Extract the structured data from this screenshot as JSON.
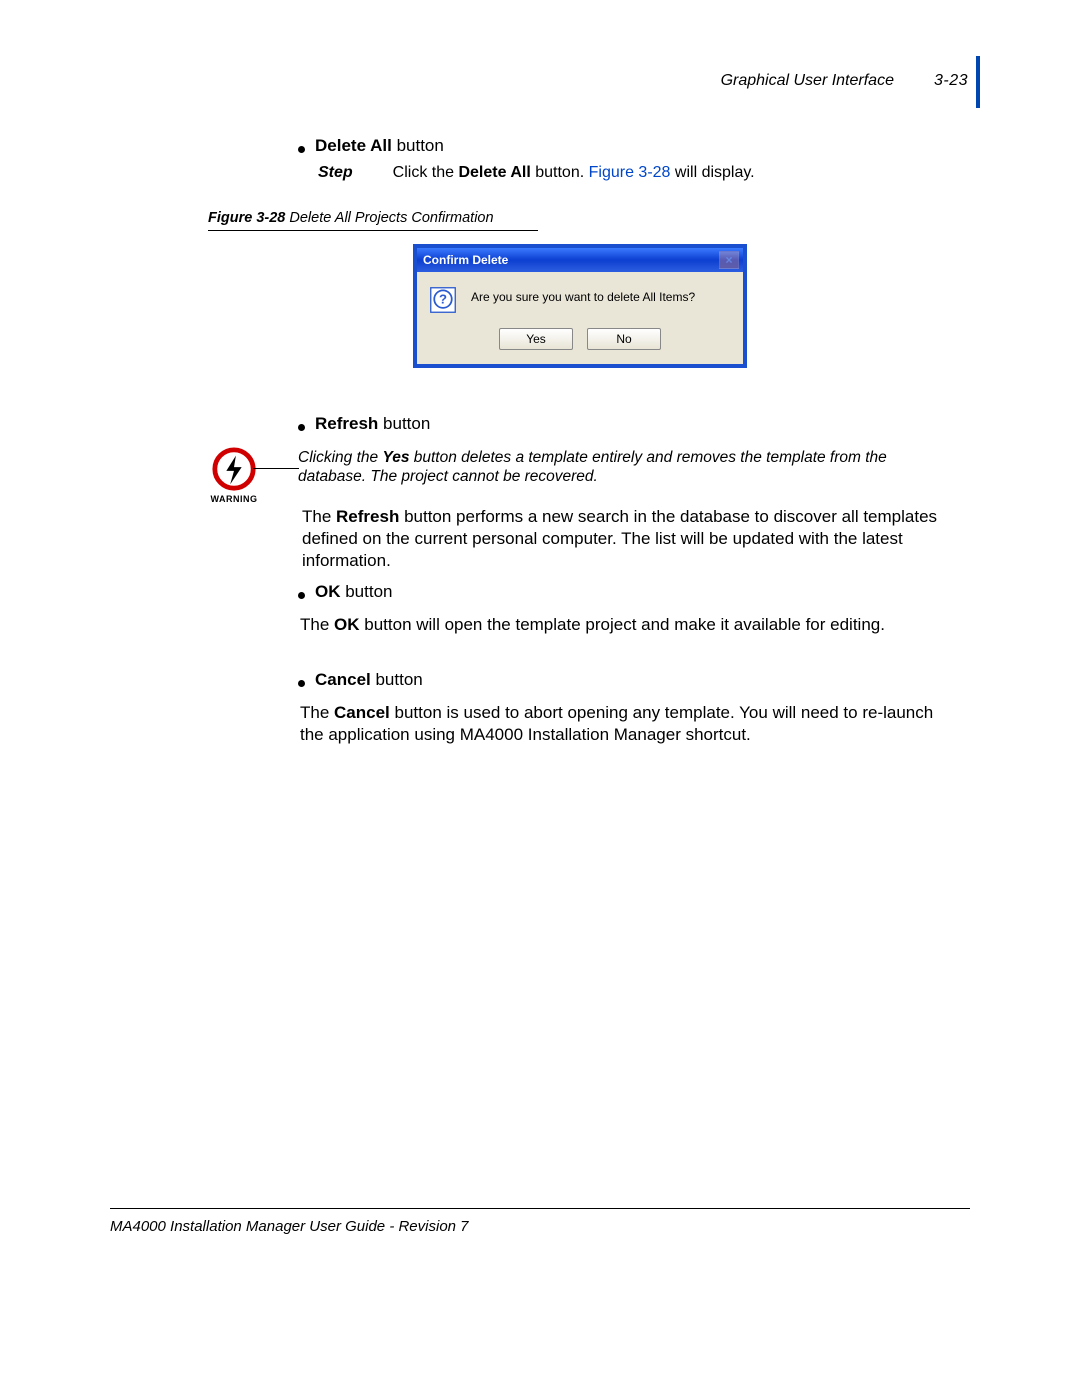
{
  "header": {
    "section": "Graphical User Interface",
    "page_num": "3-23"
  },
  "bullets": {
    "delete_all": {
      "bold": "Delete All",
      "rest": " button"
    },
    "refresh": {
      "bold": "Refresh",
      "rest": " button"
    },
    "ok": {
      "bold": "OK",
      "rest": " button"
    },
    "cancel": {
      "bold": "Cancel",
      "rest": " button"
    }
  },
  "step": {
    "label": "Step",
    "pre": "Click the ",
    "bold": "Delete All",
    "mid": " button. ",
    "link": "Figure 3-28",
    "post": " will display."
  },
  "figure": {
    "label": "Figure 3-28",
    "caption": "  Delete All Projects Confirmation"
  },
  "dialog": {
    "title": "Confirm Delete",
    "close": "×",
    "text": "Are you sure you want to delete All Items?",
    "yes": "Yes",
    "no": "No"
  },
  "warning": {
    "label": "WARNING",
    "pre": "Clicking the ",
    "bold": "Yes",
    "post": " button deletes a template entirely and removes the template from the database. The project cannot be recovered."
  },
  "paras": {
    "refresh": {
      "pre": "The ",
      "bold": "Refresh",
      "post": " button performs a new search in the database to discover all templates defined on the current personal computer. The list will be updated with the latest information."
    },
    "ok": {
      "pre": "The ",
      "bold": "OK",
      "post": " button will open the template project and make it available for editing."
    },
    "cancel": {
      "pre": "The ",
      "bold": "Cancel",
      "post": " button is used to abort opening any template. You will need to re-launch the application using MA4000 Installation Manager shortcut."
    }
  },
  "footer": "MA4000 Installation Manager User Guide - Revision 7"
}
